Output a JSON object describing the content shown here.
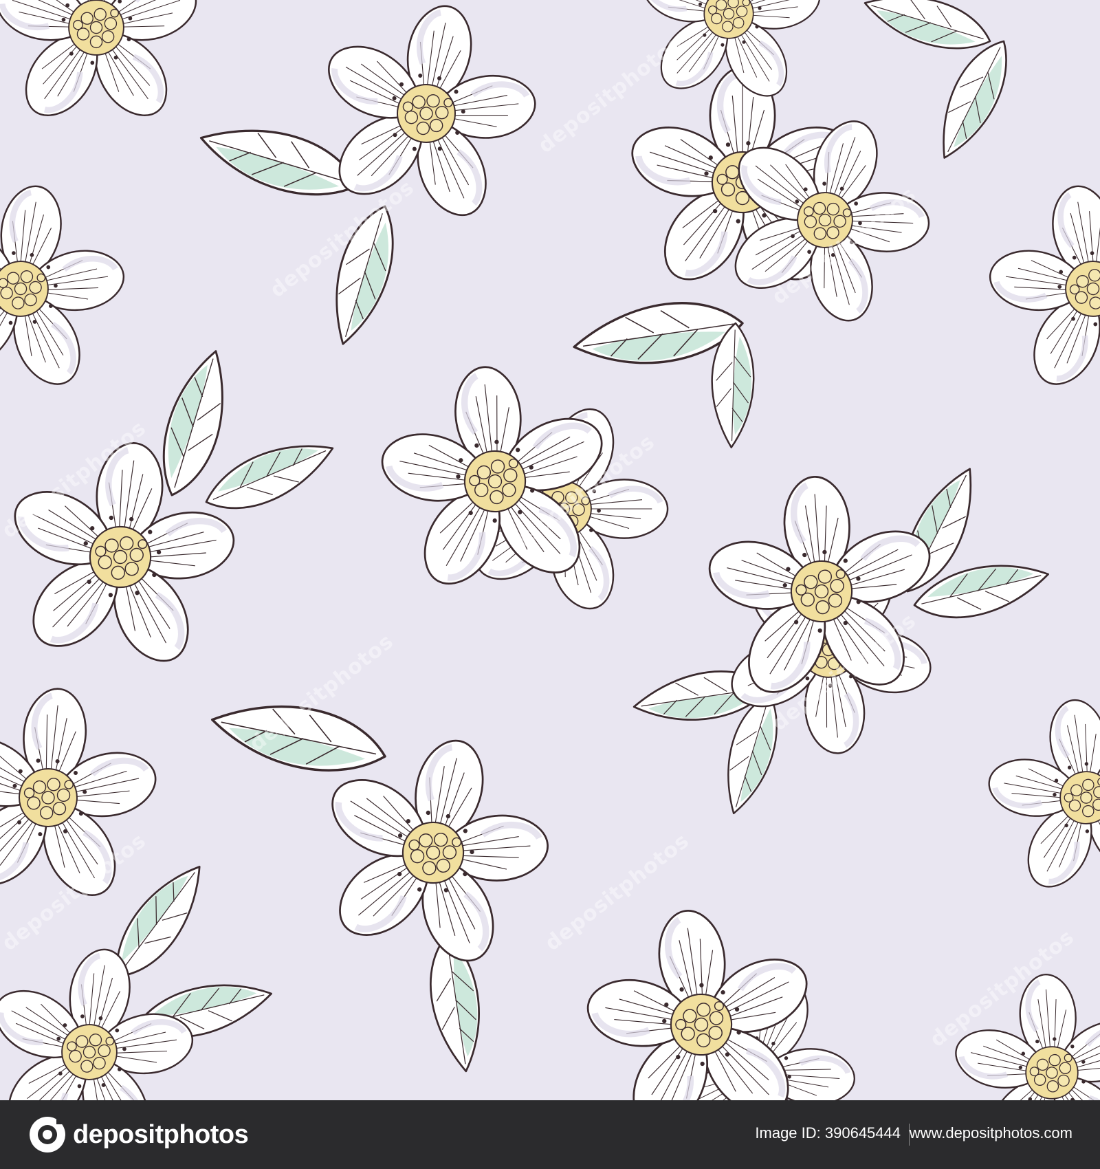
{
  "background_color": "#e9e6f1",
  "petal_color": "#ffffff",
  "outline_color": "#3a2a2e",
  "leaf_color": "#cde8dc",
  "center_color": "#f1df9e",
  "watermark": {
    "text": "depositphotos"
  },
  "footer": {
    "background_color": "#2b2b2d",
    "logo_text": "depositphotos",
    "logo_icon": "depositphotos-logo-icon",
    "image_id": "Image ID: 390645444",
    "site": "www.depositphotos.com"
  }
}
